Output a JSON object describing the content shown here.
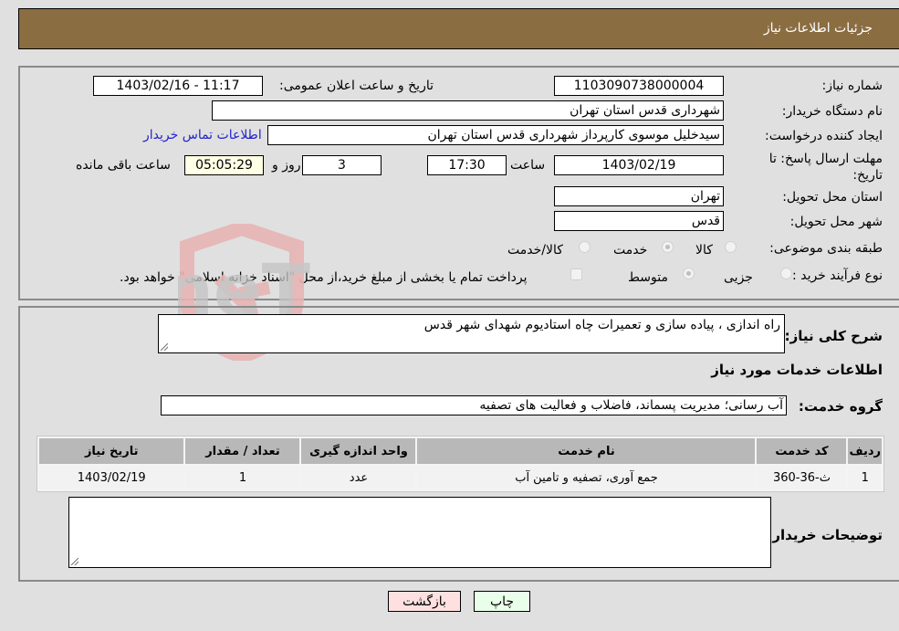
{
  "header": {
    "title": "جزئیات اطلاعات نیاز"
  },
  "form": {
    "need_number": {
      "label": "شماره نیاز:",
      "value": "1103090738000004"
    },
    "announce_datetime": {
      "label": "تاریخ و ساعت اعلان عمومی:",
      "value": "1403/02/16 - 11:17"
    },
    "buyer_org": {
      "label": "نام دستگاه خریدار:",
      "value": "شهرداری قدس استان تهران"
    },
    "requester": {
      "label": "ایجاد کننده درخواست:",
      "value": "سیدخلیل موسوی کارپرداز شهرداری قدس استان تهران"
    },
    "buyer_contact_link": "اطلاعات تماس خریدار",
    "deadline": {
      "label": "مهلت ارسال پاسخ: تا تاریخ:",
      "date": "1403/02/19",
      "time_label": "ساعت",
      "time": "17:30",
      "days": "3",
      "days_label": "روز و",
      "remaining": "05:05:29",
      "remaining_label": "ساعت باقی مانده"
    },
    "delivery_province": {
      "label": "استان محل تحویل:",
      "value": "تهران"
    },
    "delivery_city": {
      "label": "شهر محل تحویل:",
      "value": "قدس"
    },
    "category": {
      "label": "طبقه بندی موضوعی:",
      "options": [
        "کالا",
        "خدمت",
        "کالا/خدمت"
      ],
      "selected": "خدمت"
    },
    "purchase_type": {
      "label": "نوع فرآیند خرید :",
      "options": [
        "جزیی",
        "متوسط"
      ],
      "selected": "متوسط",
      "treasury_note": "پرداخت تمام یا بخشی از مبلغ خرید،از محل \"اسناد خزانه اسلامی\" خواهد بود."
    }
  },
  "details": {
    "summary_label": "شرح کلی نیاز:",
    "summary_value": "راه اندازی ، پیاده سازی  و تعمیرات چاه استادیوم شهدای شهر قدس",
    "services_heading": "اطلاعات خدمات مورد نیاز",
    "service_group_label": "گروه خدمت:",
    "service_group_value": "آب رسانی؛ مدیریت پسماند، فاضلاب و فعالیت های تصفیه",
    "table": {
      "headers": [
        "ردیف",
        "کد خدمت",
        "نام خدمت",
        "واحد اندازه گیری",
        "تعداد / مقدار",
        "تاریخ نیاز"
      ],
      "rows": [
        [
          "1",
          "ث-36-360",
          "جمع آوری، تصفیه و تامین آب",
          "عدد",
          "1",
          "1403/02/19"
        ]
      ]
    },
    "buyer_notes_label": "توضیحات خریدار:",
    "buyer_notes_value": ""
  },
  "buttons": {
    "print": "چاپ",
    "back": "بازگشت"
  },
  "watermark": {
    "text": "AriaTender.neT"
  },
  "colors": {
    "header": "#8b6d42",
    "print_button": "#eaffea",
    "back_button": "#ffe0e0",
    "link": "#2222cc"
  }
}
